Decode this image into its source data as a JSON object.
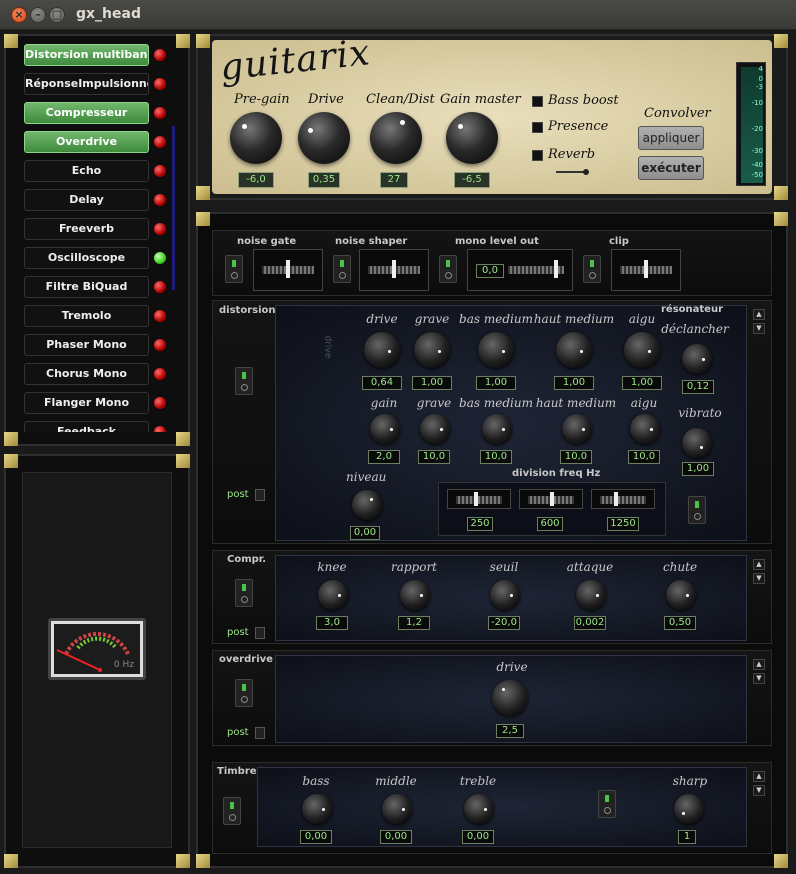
{
  "window": {
    "title": "gx_head"
  },
  "plugins": [
    {
      "label": "Distorsion multibande",
      "on": true,
      "led": "red"
    },
    {
      "label": "RéponseImpulsionnelle",
      "on": false,
      "led": "red"
    },
    {
      "label": "Compresseur",
      "on": true,
      "led": "red"
    },
    {
      "label": "Overdrive",
      "on": true,
      "led": "red"
    },
    {
      "label": "Echo",
      "on": false,
      "led": "red"
    },
    {
      "label": "Delay",
      "on": false,
      "led": "red"
    },
    {
      "label": "Freeverb",
      "on": false,
      "led": "red"
    },
    {
      "label": "Oscilloscope",
      "on": false,
      "led": "green"
    },
    {
      "label": "Filtre BiQuad",
      "on": false,
      "led": "red"
    },
    {
      "label": "Tremolo",
      "on": false,
      "led": "red"
    },
    {
      "label": "Phaser Mono",
      "on": false,
      "led": "red"
    },
    {
      "label": "Chorus Mono",
      "on": false,
      "led": "red"
    },
    {
      "label": "Flanger Mono",
      "on": false,
      "led": "red"
    },
    {
      "label": "Feedback",
      "on": false,
      "led": "red"
    }
  ],
  "meter": {
    "hz": "0 Hz"
  },
  "head": {
    "logo": "guitarix",
    "knobs": [
      {
        "label": "Pre-gain",
        "value": "-6,0"
      },
      {
        "label": "Drive",
        "value": "0,35"
      },
      {
        "label": "Clean/Dist",
        "value": "27"
      },
      {
        "label": "Gain master",
        "value": "-6,5"
      }
    ],
    "checks": [
      "Bass boost",
      "Presence",
      "Reverb"
    ],
    "convolver": {
      "title": "Convolver",
      "apply": "appliquer",
      "run": "exécuter"
    },
    "vu_ticks": [
      "4",
      "0",
      "-3",
      "-10",
      "-20",
      "-30",
      "-40",
      "-50"
    ]
  },
  "top_row": {
    "noise_gate": "noise gate",
    "noise_shaper": "noise shaper",
    "mono_level_out": "mono level out",
    "mono_value": "0,0",
    "clip": "clip"
  },
  "distorsion": {
    "title": "distorsion",
    "side_label": "drive",
    "row1": [
      {
        "label": "drive",
        "value": "0,64"
      },
      {
        "label": "grave",
        "value": "1,00"
      },
      {
        "label": "bas medium",
        "value": "1,00"
      },
      {
        "label": "haut medium",
        "value": "1,00"
      },
      {
        "label": "aigu",
        "value": "1,00"
      }
    ],
    "resonator_title": "résonateur",
    "resonator_knob": {
      "label": "déclancher",
      "value": "0,12"
    },
    "row2": [
      {
        "label": "gain",
        "value": "2,0"
      },
      {
        "label": "grave",
        "value": "10,0"
      },
      {
        "label": "bas medium",
        "value": "10,0"
      },
      {
        "label": "haut medium",
        "value": "10,0"
      },
      {
        "label": "aigu",
        "value": "10,0"
      }
    ],
    "vibrato": {
      "label": "vibrato",
      "value": "1,00"
    },
    "niveau": {
      "label": "niveau",
      "value": "0,00"
    },
    "freq_title": "division freq Hz",
    "freqs": [
      "250",
      "600",
      "1250"
    ],
    "post": "post"
  },
  "compr": {
    "title": "Compr.",
    "knobs": [
      {
        "label": "knee",
        "value": "3,0"
      },
      {
        "label": "rapport",
        "value": "1,2"
      },
      {
        "label": "seuil",
        "value": "-20,0"
      },
      {
        "label": "attaque",
        "value": "0,002"
      },
      {
        "label": "chute",
        "value": "0,50"
      }
    ],
    "post": "post"
  },
  "overdrive": {
    "title": "overdrive",
    "knob": {
      "label": "drive",
      "value": "2,5"
    },
    "post": "post"
  },
  "timbre": {
    "title": "Timbre",
    "knobs": [
      {
        "label": "bass",
        "value": "0,00"
      },
      {
        "label": "middle",
        "value": "0,00"
      },
      {
        "label": "treble",
        "value": "0,00"
      }
    ],
    "sharp": {
      "label": "sharp",
      "value": "1"
    }
  }
}
